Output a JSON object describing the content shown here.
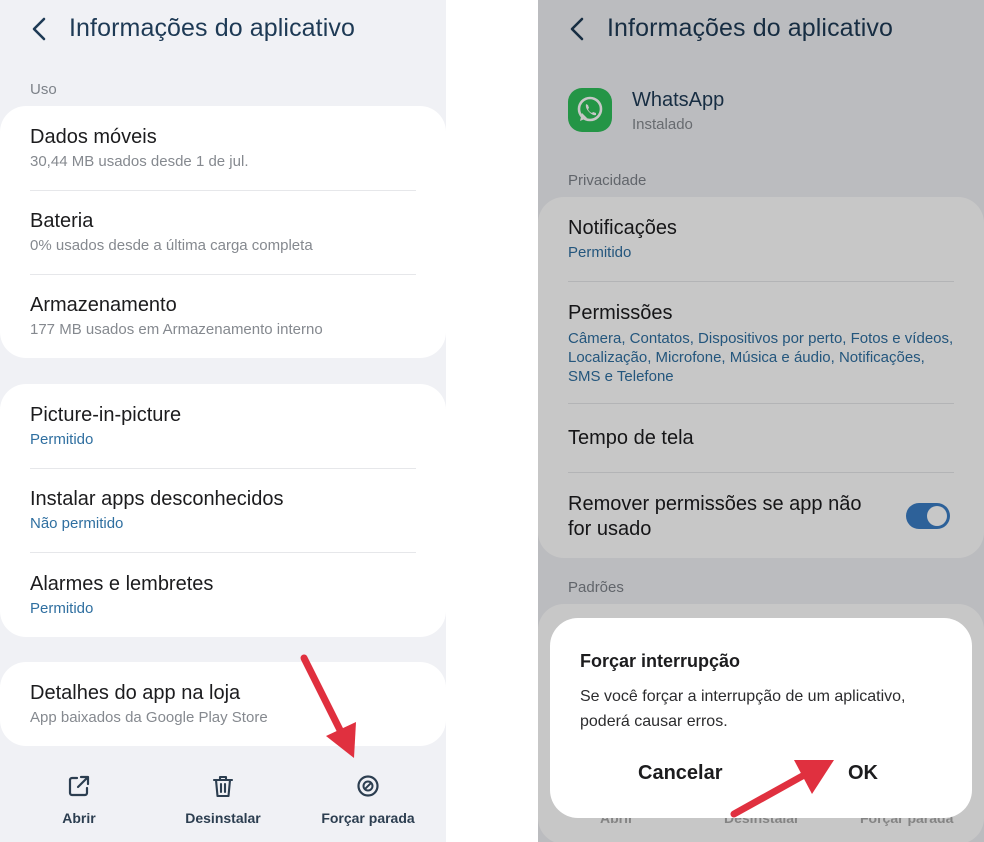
{
  "left": {
    "header": {
      "title": "Informações do aplicativo"
    },
    "uso_label": "Uso",
    "card1": [
      {
        "title": "Dados móveis",
        "sub": "30,44 MB usados desde 1 de jul."
      },
      {
        "title": "Bateria",
        "sub": "0% usados desde a última carga completa"
      },
      {
        "title": "Armazenamento",
        "sub": "177 MB usados em Armazenamento interno"
      }
    ],
    "card2": [
      {
        "title": "Picture-in-picture",
        "sub": "Permitido"
      },
      {
        "title": "Instalar apps desconhecidos",
        "sub": "Não permitido"
      },
      {
        "title": "Alarmes e lembretes",
        "sub": "Permitido"
      }
    ],
    "card3": {
      "title": "Detalhes do app na loja",
      "sub": "App baixados da Google Play Store"
    },
    "bottom_bar": {
      "open": "Abrir",
      "uninstall": "Desinstalar",
      "force_stop": "Forçar parada"
    }
  },
  "right": {
    "header": {
      "title": "Informações do aplicativo"
    },
    "app": {
      "name": "WhatsApp",
      "status": "Instalado"
    },
    "privacy_label": "Privacidade",
    "notifications": {
      "title": "Notificações",
      "sub": "Permitido"
    },
    "permissions": {
      "title": "Permissões",
      "sub": "Câmera, Contatos, Dispositivos por perto, Fotos e vídeos, Localização, Microfone, Música e áudio, Notificações, SMS e Telefone"
    },
    "screen_time": {
      "title": "Tempo de tela"
    },
    "remove_permissions": {
      "title_line1": "Remover permissões se app não",
      "title_line2": "for usado",
      "enabled": true
    },
    "defaults_label": "Padrões",
    "dialog": {
      "title": "Forçar interrupção",
      "body": "Se você forçar a interrupção de um aplicativo, poderá causar erros.",
      "cancel": "Cancelar",
      "ok": "OK"
    },
    "bottom_bar_behind": {
      "open": "Abrir",
      "uninstall": "Desinstalar",
      "force_stop": "Forçar parada"
    }
  },
  "colors": {
    "accent": "#3a7dc4",
    "link_blue": "#2f6fa0",
    "arrow_red": "#e0303f",
    "whatsapp_green": "#2fbf5a",
    "background": "#f0f1f5"
  }
}
